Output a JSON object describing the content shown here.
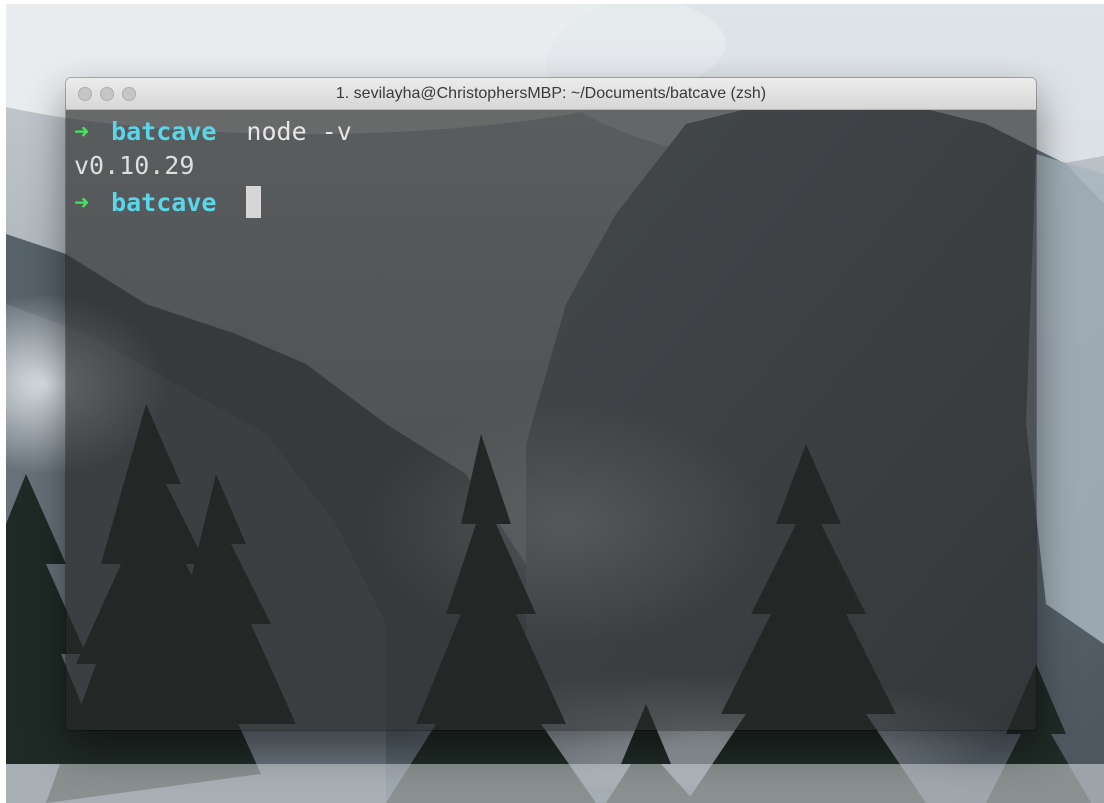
{
  "window": {
    "title": "1. sevilayha@ChristophersMBP: ~/Documents/batcave (zsh)"
  },
  "terminal": {
    "prompt_arrow": "➜",
    "lines": [
      {
        "type": "prompt",
        "directory": "batcave",
        "command": "node -v"
      },
      {
        "type": "output",
        "text": "v0.10.29"
      },
      {
        "type": "prompt",
        "directory": "batcave",
        "command": ""
      }
    ]
  },
  "colors": {
    "prompt_arrow": "#45e35f",
    "directory": "#5ad6ea",
    "text": "#dcdcdc",
    "title_bar": "#e2e2e2",
    "traffic_lights": "#c6c6c6"
  },
  "icons": {
    "traffic_lights": [
      "close-icon",
      "minimize-icon",
      "zoom-icon"
    ],
    "cursor": "block-cursor-icon"
  },
  "background": {
    "image": "mountain-wallpaper"
  }
}
